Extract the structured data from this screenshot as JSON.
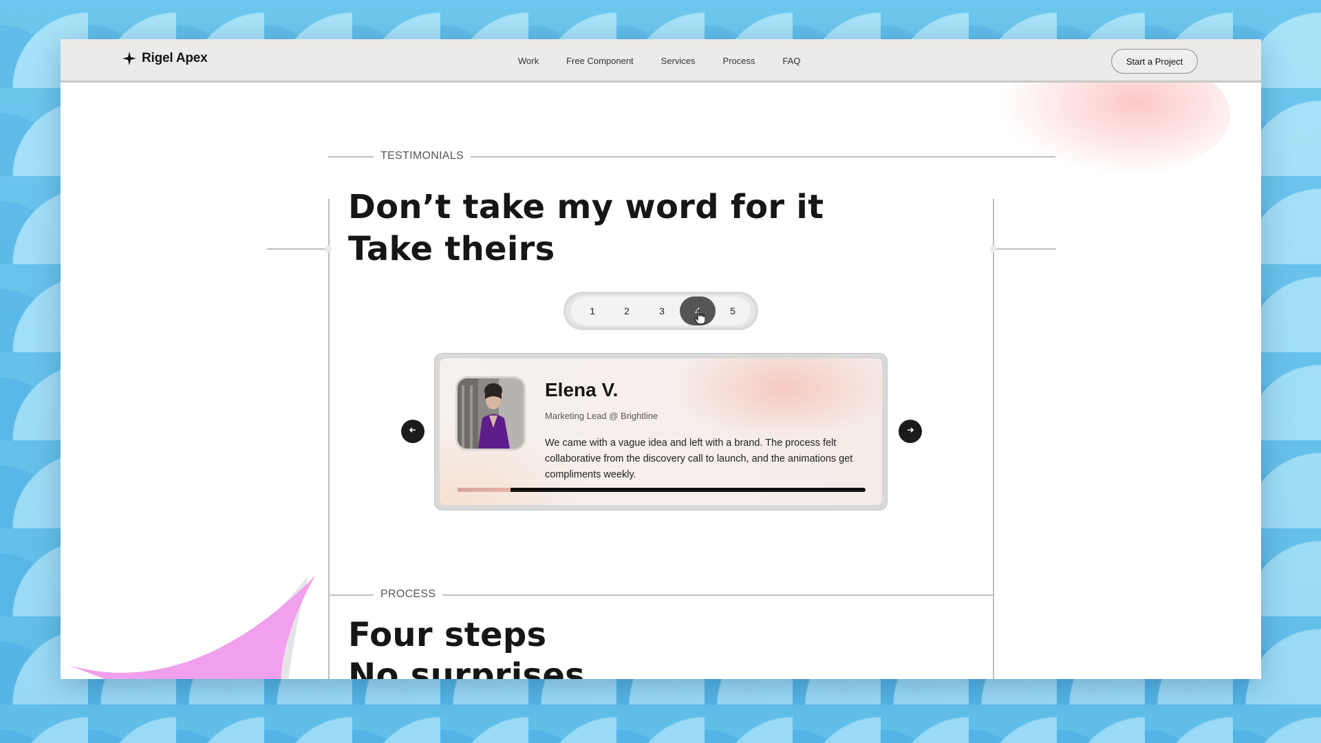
{
  "brand": {
    "name": "Rigel Apex",
    "icon": "sparkle-icon"
  },
  "nav": {
    "links": [
      "Work",
      "Free Component",
      "Services",
      "Process",
      "FAQ"
    ],
    "cta_label": "Start a Project"
  },
  "testimonials": {
    "label": "TESTIMONIALS",
    "heading_line1": "Don’t take my word for it",
    "heading_line2": "Take theirs",
    "pages": [
      "1",
      "2",
      "3",
      "4",
      "5"
    ],
    "active_page": 4,
    "card": {
      "name": "Elena V.",
      "role": "Marketing Lead @ Brightline",
      "quote": "We came with a vague idea and left with a brand. The process felt collaborative from the discovery call to launch, and the animations get compliments weekly.",
      "progress": 0.13
    },
    "prev_icon": "arrow-left-icon",
    "next_icon": "arrow-right-icon"
  },
  "process": {
    "label": "PROCESS",
    "heading_line1": "Four steps",
    "heading_line2": "No surprises"
  },
  "colors": {
    "accent_dark": "#1b1b1b",
    "active_page_bg": "#555555",
    "progress_fill": "#e2ac9f",
    "background": "#62c1ea"
  }
}
